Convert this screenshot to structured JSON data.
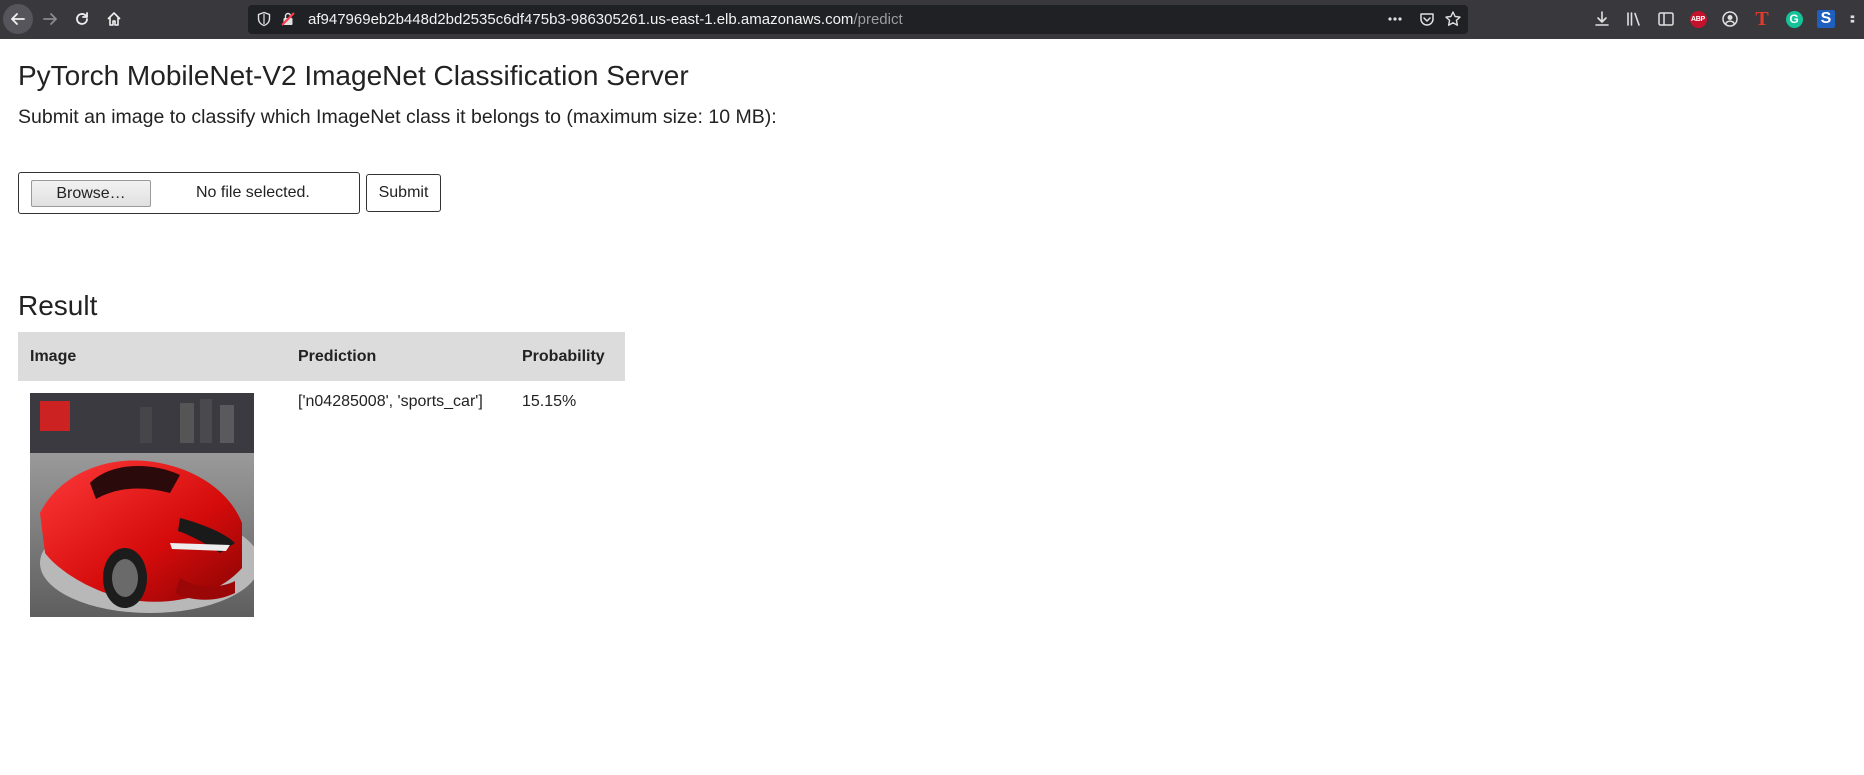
{
  "browser": {
    "url_host": "af947969eb2b448d2bd2535c6df475b3-986305261.us-east-1.elb.amazonaws.com",
    "url_path": "/predict",
    "more_label": "•••",
    "extensions": {
      "abp_label": "ABP",
      "t_label": "T",
      "g_label": "G",
      "s_label": "S"
    }
  },
  "page": {
    "title": "PyTorch MobileNet-V2 ImageNet Classification Server",
    "intro": "Submit an image to classify which ImageNet class it belongs to (maximum size: 10 MB):",
    "browse_label": "Browse…",
    "file_status": "No file selected.",
    "submit_label": "Submit"
  },
  "result": {
    "heading": "Result",
    "columns": [
      "Image",
      "Prediction",
      "Probability"
    ],
    "rows": [
      {
        "prediction": "['n04285008', 'sports_car']",
        "probability": "15.15%"
      }
    ]
  },
  "colors": {
    "toolbar_bg": "#38383d",
    "urlbar_bg": "#202125",
    "table_header_bg": "#dcdcdc"
  }
}
